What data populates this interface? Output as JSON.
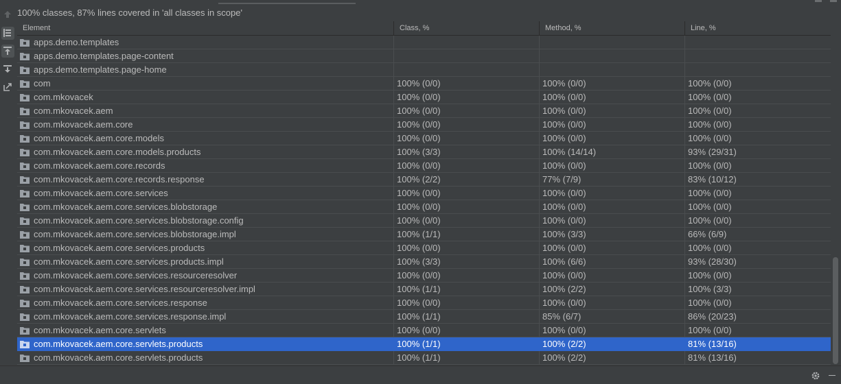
{
  "summary": "100% classes, 87% lines covered in 'all classes in scope'",
  "columns": [
    "Element",
    "Class, %",
    "Method, %",
    "Line, %"
  ],
  "rows": [
    {
      "element": "apps.demo.templates",
      "class": "",
      "method": "",
      "line": ""
    },
    {
      "element": "apps.demo.templates.page-content",
      "class": "",
      "method": "",
      "line": ""
    },
    {
      "element": "apps.demo.templates.page-home",
      "class": "",
      "method": "",
      "line": ""
    },
    {
      "element": "com",
      "class": "100% (0/0)",
      "method": "100% (0/0)",
      "line": "100% (0/0)"
    },
    {
      "element": "com.mkovacek",
      "class": "100% (0/0)",
      "method": "100% (0/0)",
      "line": "100% (0/0)"
    },
    {
      "element": "com.mkovacek.aem",
      "class": "100% (0/0)",
      "method": "100% (0/0)",
      "line": "100% (0/0)"
    },
    {
      "element": "com.mkovacek.aem.core",
      "class": "100% (0/0)",
      "method": "100% (0/0)",
      "line": "100% (0/0)"
    },
    {
      "element": "com.mkovacek.aem.core.models",
      "class": "100% (0/0)",
      "method": "100% (0/0)",
      "line": "100% (0/0)"
    },
    {
      "element": "com.mkovacek.aem.core.models.products",
      "class": "100% (3/3)",
      "method": "100% (14/14)",
      "line": "93% (29/31)"
    },
    {
      "element": "com.mkovacek.aem.core.records",
      "class": "100% (0/0)",
      "method": "100% (0/0)",
      "line": "100% (0/0)"
    },
    {
      "element": "com.mkovacek.aem.core.records.response",
      "class": "100% (2/2)",
      "method": "77% (7/9)",
      "line": "83% (10/12)"
    },
    {
      "element": "com.mkovacek.aem.core.services",
      "class": "100% (0/0)",
      "method": "100% (0/0)",
      "line": "100% (0/0)"
    },
    {
      "element": "com.mkovacek.aem.core.services.blobstorage",
      "class": "100% (0/0)",
      "method": "100% (0/0)",
      "line": "100% (0/0)"
    },
    {
      "element": "com.mkovacek.aem.core.services.blobstorage.config",
      "class": "100% (0/0)",
      "method": "100% (0/0)",
      "line": "100% (0/0)"
    },
    {
      "element": "com.mkovacek.aem.core.services.blobstorage.impl",
      "class": "100% (1/1)",
      "method": "100% (3/3)",
      "line": "66% (6/9)"
    },
    {
      "element": "com.mkovacek.aem.core.services.products",
      "class": "100% (0/0)",
      "method": "100% (0/0)",
      "line": "100% (0/0)"
    },
    {
      "element": "com.mkovacek.aem.core.services.products.impl",
      "class": "100% (3/3)",
      "method": "100% (6/6)",
      "line": "93% (28/30)"
    },
    {
      "element": "com.mkovacek.aem.core.services.resourceresolver",
      "class": "100% (0/0)",
      "method": "100% (0/0)",
      "line": "100% (0/0)"
    },
    {
      "element": "com.mkovacek.aem.core.services.resourceresolver.impl",
      "class": "100% (1/1)",
      "method": "100% (2/2)",
      "line": "100% (3/3)"
    },
    {
      "element": "com.mkovacek.aem.core.services.response",
      "class": "100% (0/0)",
      "method": "100% (0/0)",
      "line": "100% (0/0)"
    },
    {
      "element": "com.mkovacek.aem.core.services.response.impl",
      "class": "100% (1/1)",
      "method": "85% (6/7)",
      "line": "86% (20/23)"
    },
    {
      "element": "com.mkovacek.aem.core.servlets",
      "class": "100% (0/0)",
      "method": "100% (0/0)",
      "line": "100% (0/0)"
    },
    {
      "element": "com.mkovacek.aem.core.servlets.products",
      "class": "100% (1/1)",
      "method": "100% (2/2)",
      "line": "81% (13/16)",
      "selected": true
    },
    {
      "element": "com.mkovacek.aem.core.servlets.products",
      "class": "100% (1/1)",
      "method": "100% (2/2)",
      "line": "81% (13/16)"
    }
  ],
  "icons": {
    "toolbar": [
      "up-arrow-icon",
      "flatten-packages-icon",
      "import-icon",
      "export-icon",
      "generate-report-icon"
    ],
    "row": "package-folder-icon",
    "bottom": [
      "gear-icon",
      "minimize-icon"
    ]
  },
  "colors": {
    "background": "#3c3f41",
    "selection": "#2f65ca",
    "text": "#bbbbbb"
  }
}
